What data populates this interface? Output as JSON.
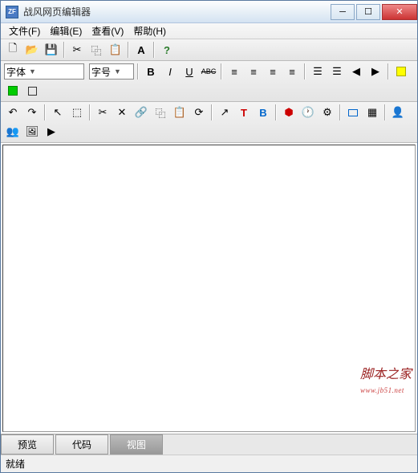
{
  "window": {
    "title": "战风网页编辑器",
    "app_icon_text": "ZF"
  },
  "win_controls": {
    "min": "─",
    "max": "☐",
    "close": "✕"
  },
  "menu": {
    "file": "文件(F)",
    "edit": "编辑(E)",
    "view": "查看(V)",
    "help": "帮助(H)"
  },
  "toolbar1": {
    "new": "🗋",
    "open": "📂",
    "save": "💾",
    "cut": "✂",
    "copy": "📋",
    "paste": "📄",
    "font_dialog": "A",
    "help": "?"
  },
  "fonts": {
    "font_label": "字体",
    "size_label": "字号"
  },
  "format": {
    "bold": "B",
    "italic": "I",
    "underline": "U",
    "strike": "ABC"
  },
  "tabs": {
    "preview": "预览",
    "code": "代码",
    "view": "视图"
  },
  "status": {
    "ready": "就绪"
  },
  "watermark": {
    "text": "脚本之家",
    "url": "www.jb51.net"
  }
}
